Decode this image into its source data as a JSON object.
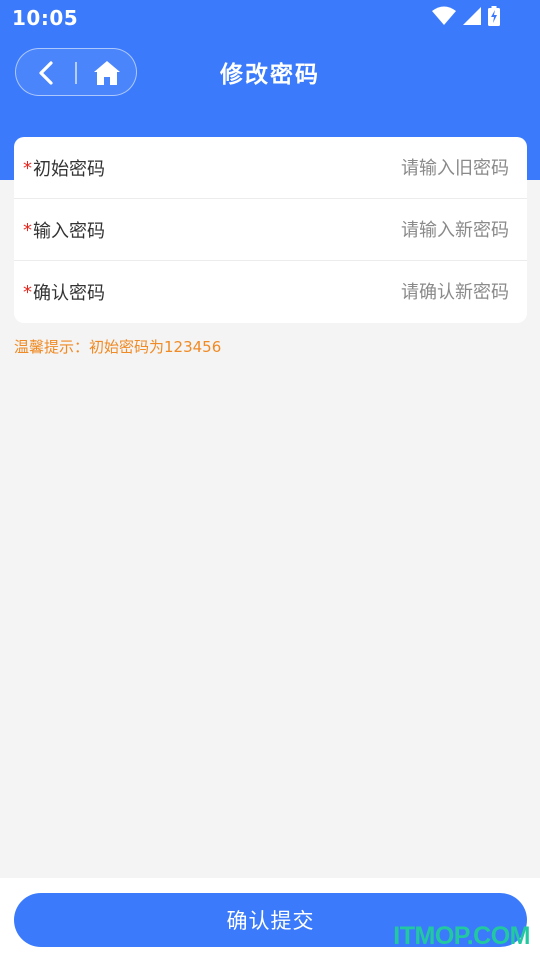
{
  "status_bar": {
    "time": "10:05",
    "icons": [
      "wifi-icon",
      "signal-icon",
      "battery-charging-icon"
    ]
  },
  "header": {
    "title": "修改密码",
    "back_icon": "chevron-left-icon",
    "home_icon": "home-icon",
    "background_color": "#3b7bfb"
  },
  "form": {
    "fields": [
      {
        "required_mark": "*",
        "label": "初始密码",
        "placeholder": "请输入旧密码",
        "value": ""
      },
      {
        "required_mark": "*",
        "label": "输入密码",
        "placeholder": "请输入新密码",
        "value": ""
      },
      {
        "required_mark": "*",
        "label": "确认密码",
        "placeholder": "请确认新密码",
        "value": ""
      }
    ]
  },
  "tip": "温馨提示：初始密码为123456",
  "submit": {
    "label": "确认提交"
  },
  "watermark": "ITMOP.COM",
  "colors": {
    "primary": "#3b7bfb",
    "required": "#e8271f",
    "tip": "#f08a24",
    "watermark": "#22c9a0"
  }
}
